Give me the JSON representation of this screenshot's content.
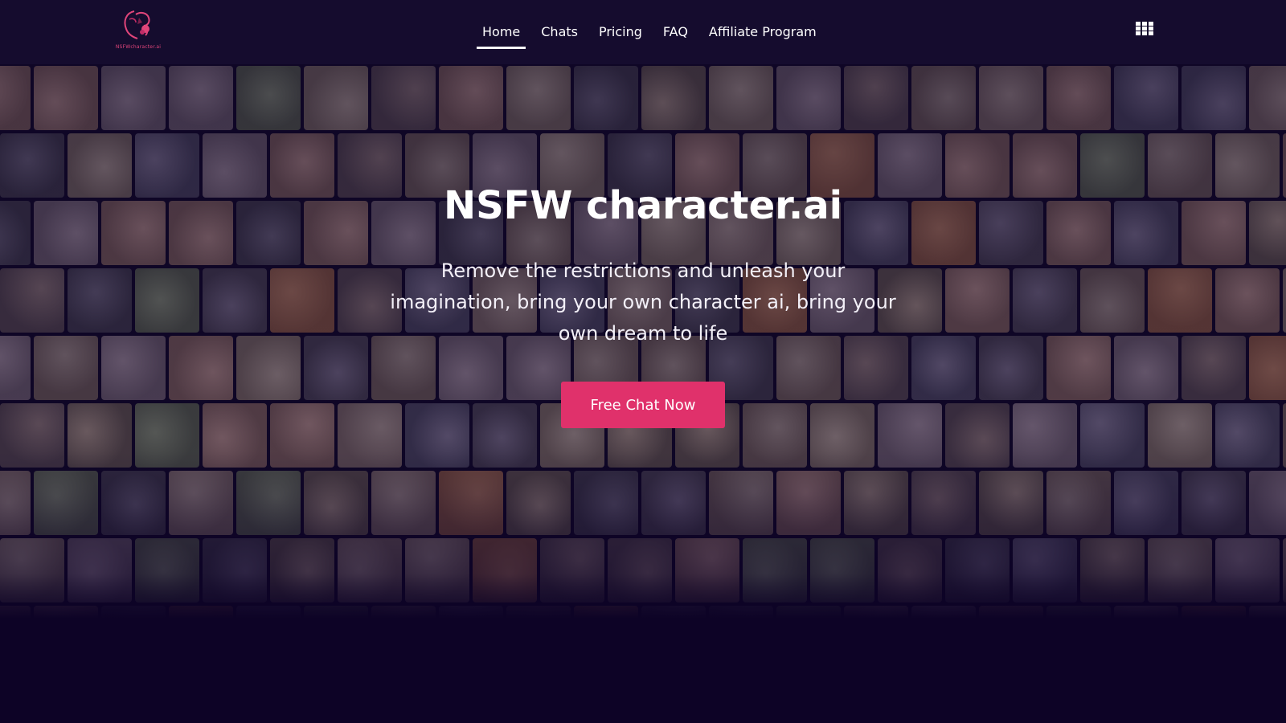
{
  "header": {
    "logo_text": "NSFWcharacter.ai",
    "nav": [
      {
        "label": "Home",
        "active": true
      },
      {
        "label": "Chats",
        "active": false
      },
      {
        "label": "Pricing",
        "active": false
      },
      {
        "label": "FAQ",
        "active": false
      },
      {
        "label": "Affiliate Program",
        "active": false
      }
    ],
    "menu_icon": "grid-menu-icon"
  },
  "hero": {
    "title": "NSFW character.ai",
    "subtitle": "Remove the restrictions and unleash your imagination, bring your own character ai, bring your own dream to life",
    "cta_label": "Free Chat Now",
    "background": "gallery-of-character-portraits"
  },
  "colors": {
    "header_bg": "#150c2e",
    "page_bg": "#0d0326",
    "accent": "#e0316b",
    "logo_pink": "#e0457a"
  }
}
